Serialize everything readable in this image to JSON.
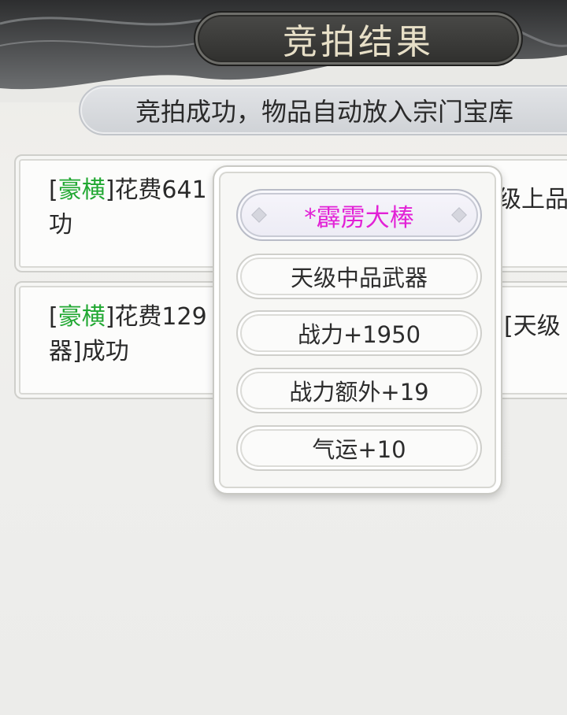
{
  "header": {
    "title": "竞拍结果"
  },
  "notice": {
    "text": "竞拍成功，物品自动放入宗门宝库"
  },
  "log": [
    {
      "tag_open": "[",
      "tag": "豪横",
      "tag_close": "]",
      "text_line1": "花费641",
      "text_line2": "功",
      "right_fragment": "级上品"
    },
    {
      "tag_open": "[",
      "tag": "豪横",
      "tag_close": "]",
      "text_line1": "花费129",
      "text_line2": "器]成功",
      "right_fragment": "[天级"
    }
  ],
  "item_popup": {
    "name": "*霹雳大棒",
    "grade": "天级中品武器",
    "stats": [
      "战力+1950",
      "战力额外+19",
      "气运+10"
    ]
  },
  "colors": {
    "tag_green": "#21a832",
    "item_name_magenta": "#e221d6",
    "title_text": "#e7dfc7"
  }
}
